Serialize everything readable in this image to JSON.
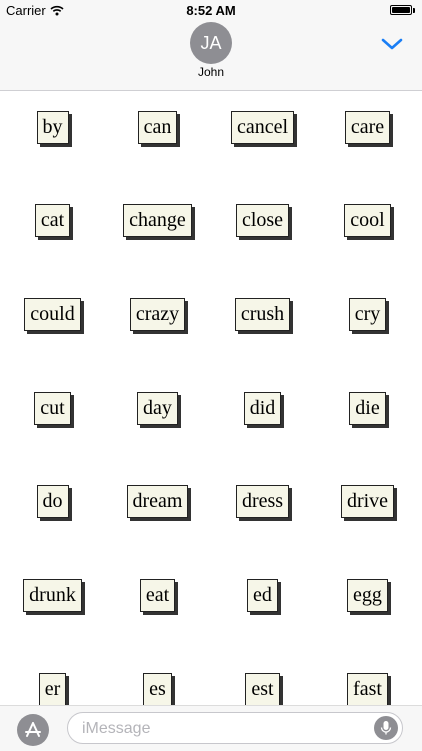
{
  "status_bar": {
    "carrier": "Carrier",
    "time": "8:52 AM",
    "icons": [
      "wifi-icon",
      "battery-icon"
    ]
  },
  "header": {
    "avatar_initials": "JA",
    "contact_name": "John",
    "collapse_icon": "chevron-down-icon"
  },
  "stickers": [
    [
      "by",
      "can",
      "cancel",
      "care"
    ],
    [
      "cat",
      "change",
      "close",
      "cool"
    ],
    [
      "could",
      "crazy",
      "crush",
      "cry"
    ],
    [
      "cut",
      "day",
      "did",
      "die"
    ],
    [
      "do",
      "dream",
      "dress",
      "drive"
    ],
    [
      "drunk",
      "eat",
      "ed",
      "egg"
    ],
    [
      "er",
      "es",
      "est",
      "fast"
    ]
  ],
  "input_bar": {
    "app_icon": "app-store-icon",
    "placeholder": "iMessage",
    "mic_icon": "microphone-icon"
  },
  "colors": {
    "accent": "#1a7ef5",
    "avatar": "#8e8e93",
    "sticker_bg": "#f6f6e8"
  }
}
